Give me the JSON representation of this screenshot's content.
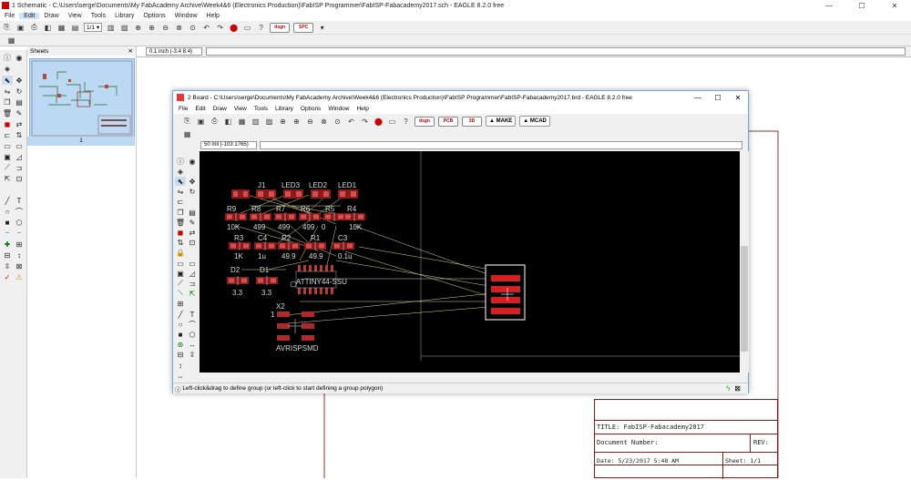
{
  "schematic": {
    "title": "1 Schematic - C:\\Users\\serge\\Documents\\My FabAcademy Archive\\Week4&6 (Electronics Production)\\FabISP Programmer\\FabISP-Fabacademy2017.sch - EAGLE 8.2.0 free",
    "menu": [
      "File",
      "Edit",
      "Draw",
      "View",
      "Tools",
      "Library",
      "Options",
      "Window",
      "Help"
    ],
    "zoom_combo": "1/1",
    "coord": "0.1 inch (-3.4 8.4)",
    "sheets_title": "Sheets",
    "sheet_number": "1",
    "title_block": {
      "title": "TITLE:  FabISP-Fabacademy2017",
      "docnum": "Document Number:",
      "rev": "REV:",
      "date": "Date: 5/23/2017 5:48 AM",
      "sheet": "Sheet: 1/1"
    },
    "winbtns": [
      "—",
      "☐",
      "✕"
    ]
  },
  "board": {
    "title": "2 Board - C:\\Users\\serge\\Documents\\My FabAcademy Archive\\Week4&6 (Electronics Production)\\FabISP Programmer\\FabISP-Fabacademy2017.brd - EAGLE 8.2.0 free",
    "menu": [
      "File",
      "Edit",
      "Draw",
      "View",
      "Tools",
      "Library",
      "Options",
      "Window",
      "Help"
    ],
    "coord": "50 mil (-103 1765)",
    "make_label": "MAKE",
    "mcad_label": "MCAD",
    "status": "Left-click&drag to define group (or left-click to start defining a group polygon)",
    "winbtns": [
      "—",
      "☐",
      "✕"
    ],
    "parts": {
      "j1": "J1",
      "led3": "LED3",
      "led2": "LED2",
      "led1": "LED1",
      "r9": "R9",
      "r8": "R8",
      "r7": "R7",
      "r6": "R6",
      "r5": "R5",
      "r4": "R4",
      "v10k_a": "10K",
      "v499_a": "499",
      "v499_b": "499",
      "v499_c": "499",
      "v0": "0",
      "v10k_b": "10K",
      "r3": "R3",
      "c4": "C4",
      "r2": "R2",
      "r1": "R1",
      "c3": "C3",
      "v1k": "1K",
      "v1u": "1u",
      "v499d": "49.9",
      "v499e": "49.9",
      "v01u": "0.1u",
      "d2": "D2",
      "d1": "D1",
      "v33a": "3.3",
      "v33b": "3.3",
      "ic": "ATTINY44-SSU",
      "x2": "X2",
      "pin1": "1",
      "avr": "AVRISPSMD"
    }
  }
}
